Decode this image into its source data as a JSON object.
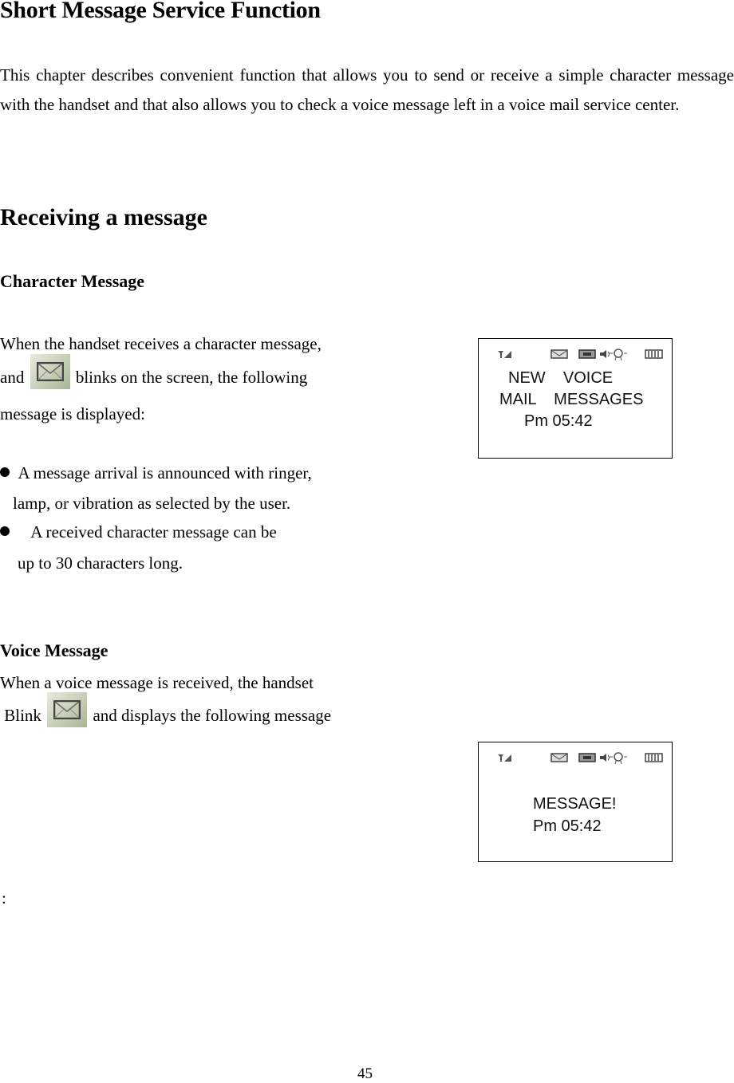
{
  "page": {
    "title": "Short Message Service Function",
    "intro": "This chapter describes convenient function that allows you to send or receive a simple character message with the handset and that also allows you to check a voice message left in a voice mail service center.",
    "section_heading": "Receiving a message",
    "page_number": "45",
    "trailing_colon": ":"
  },
  "character_message": {
    "heading": "Character Message",
    "line1": "When the handset receives a character message,",
    "line2_before": "and",
    "line2_after": "blinks on the screen, the following",
    "line3": "message is displayed:",
    "icon": "envelope-icon",
    "bullets": [
      {
        "line1": "A message arrival is announced with ringer,",
        "line2": "lamp, or vibration as selected by the user."
      },
      {
        "line1": "A received character message can be",
        "line2": "up to 30 characters long."
      }
    ],
    "screen": {
      "status_icons": [
        "signal-icon",
        "envelope-icon",
        "voicemail-icon",
        "speaker-icon",
        "ringer-icon",
        "battery-icon"
      ],
      "line1": "NEW    VOICE",
      "line2": "MAIL    MESSAGES",
      "time": "Pm 05:42"
    }
  },
  "voice_message": {
    "heading": "Voice Message",
    "line1": "When a voice message is received, the handset",
    "line2_before": "Blink",
    "line2_after": "and displays the following message",
    "icon": "envelope-icon",
    "screen": {
      "status_icons": [
        "signal-icon",
        "envelope-icon",
        "voicemail-icon",
        "speaker-icon",
        "ringer-icon",
        "battery-icon"
      ],
      "line1": "MESSAGE!",
      "time": "Pm 05:42"
    }
  }
}
